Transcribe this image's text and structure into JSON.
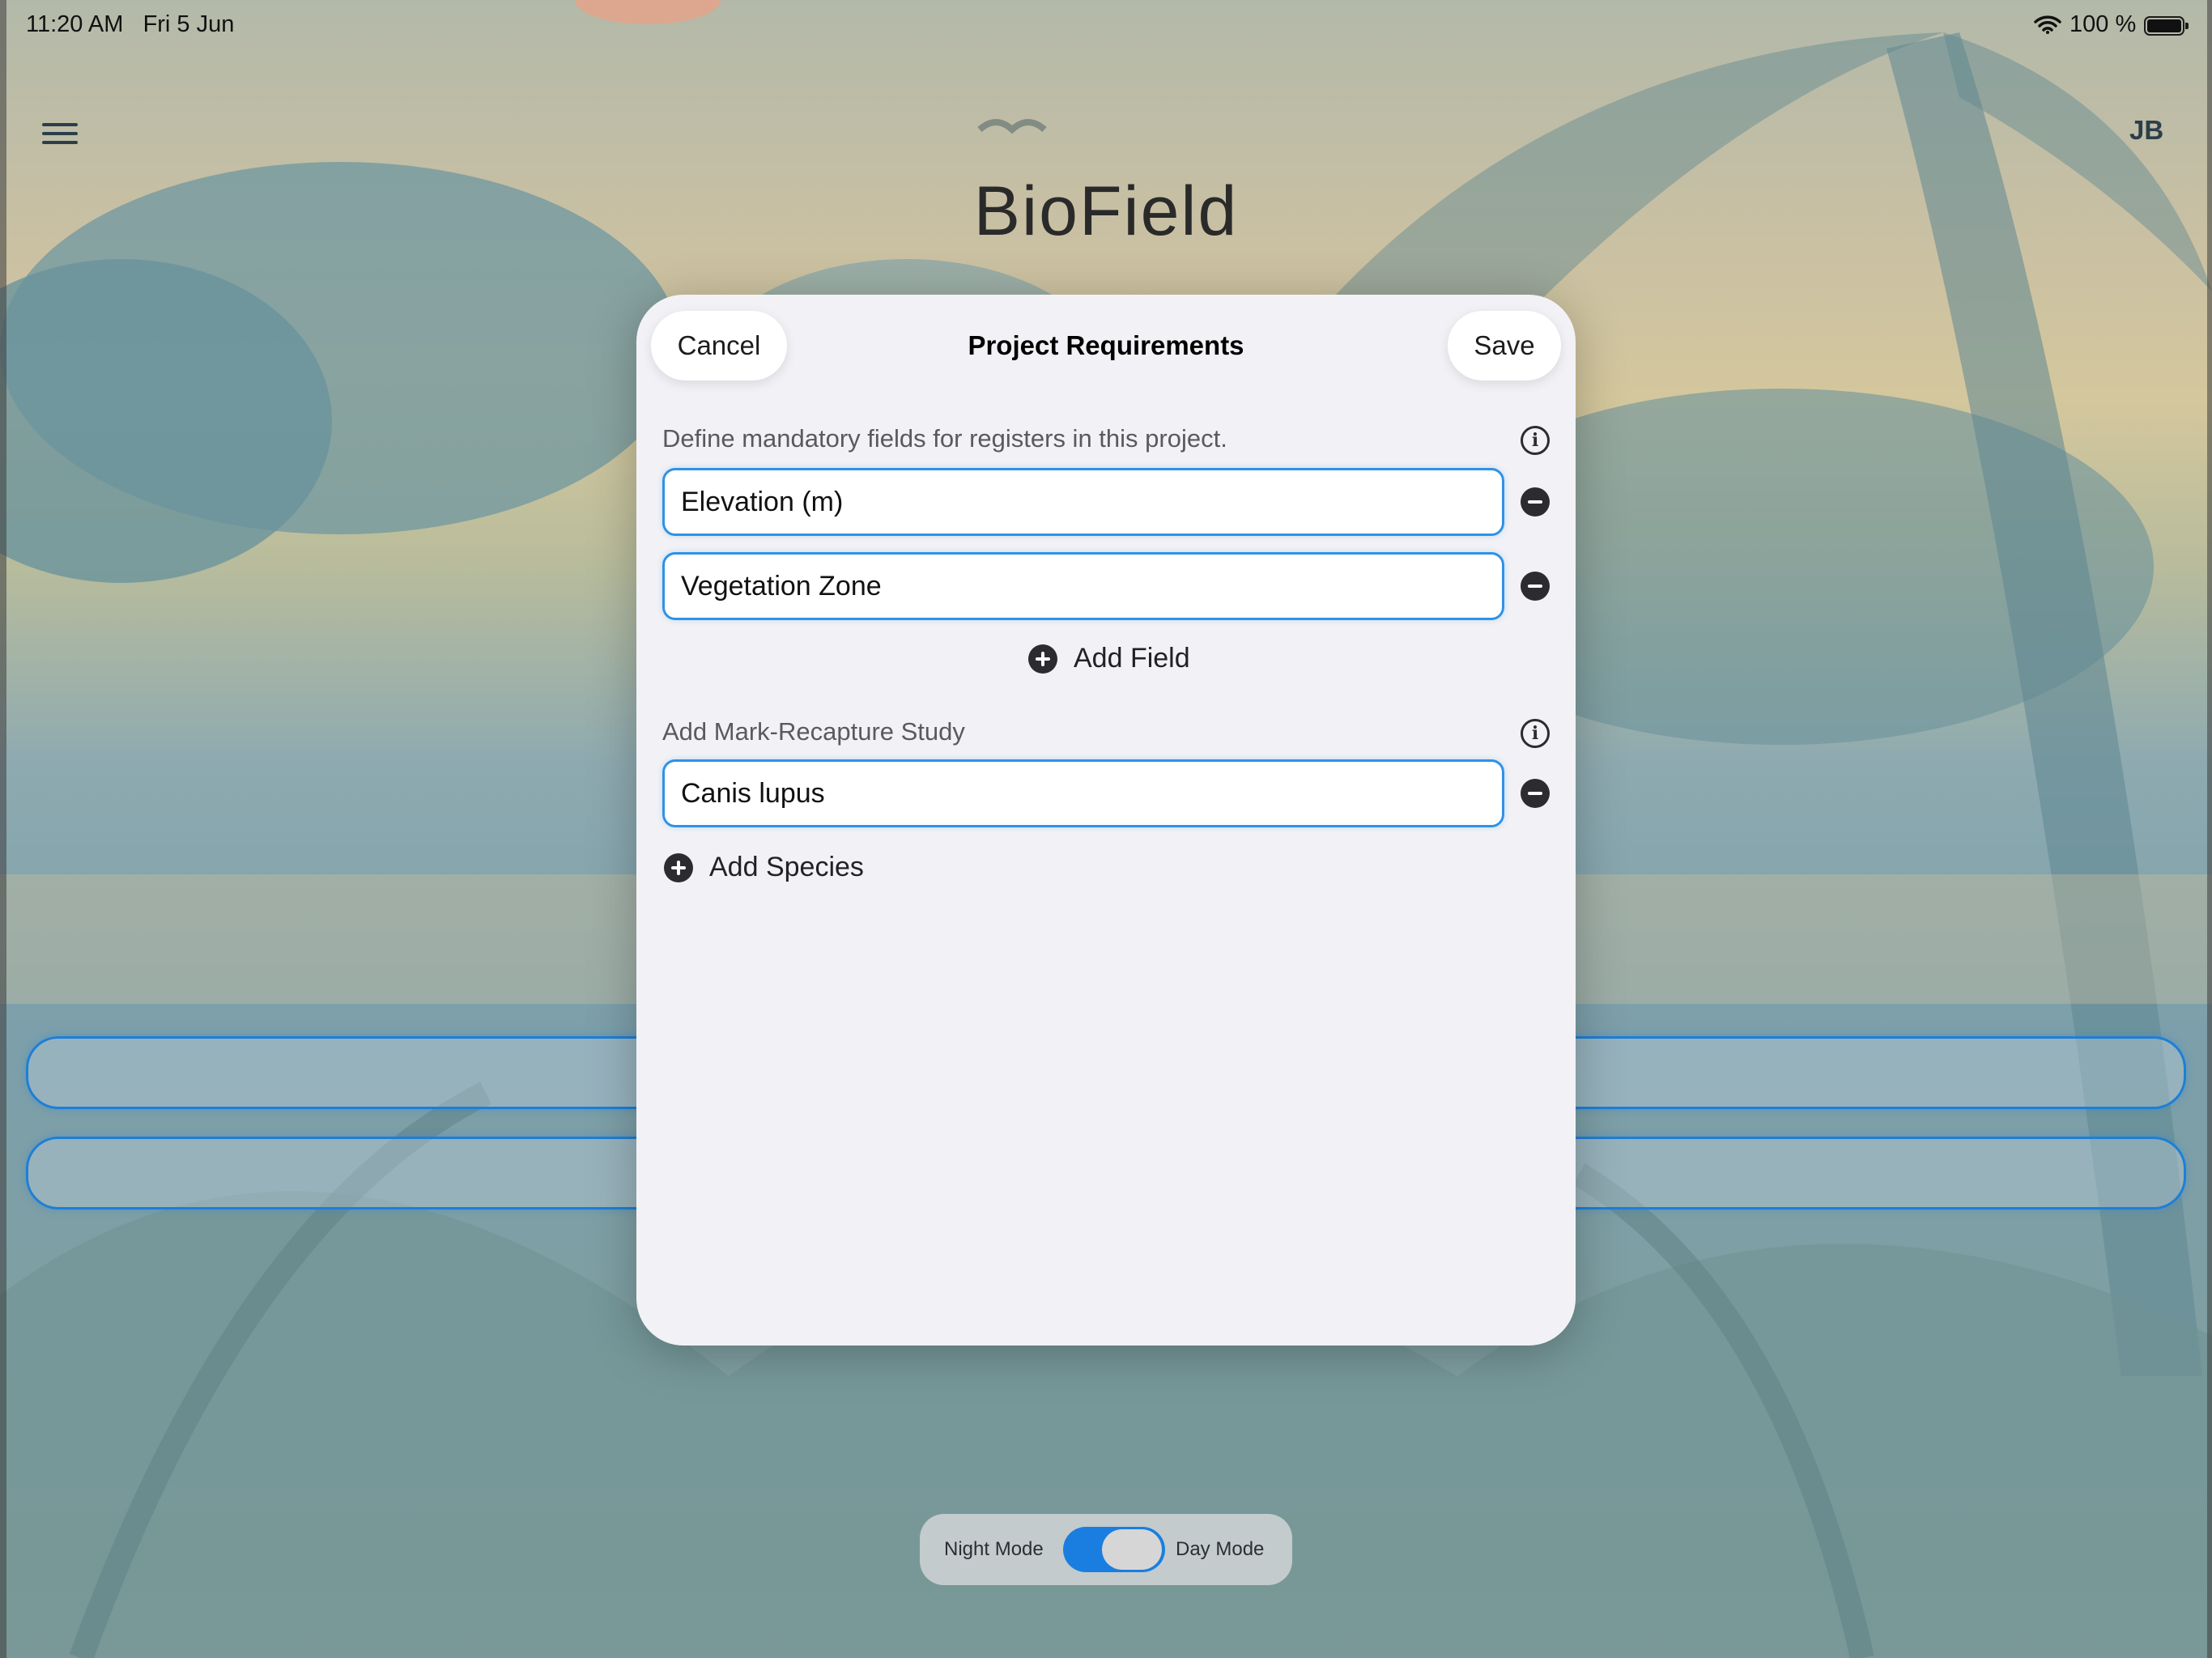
{
  "status_bar": {
    "time": "11:20 AM",
    "date": "Fri 5 Jun",
    "battery_text": "100 %"
  },
  "app": {
    "title": "BioField",
    "avatar_initials": "JB"
  },
  "mode_toggle": {
    "night_label": "Night Mode",
    "day_label": "Day Mode",
    "selected": "Day Mode"
  },
  "sheet": {
    "title": "Project Requirements",
    "cancel_label": "Cancel",
    "save_label": "Save",
    "mandatory_section": {
      "description": "Define mandatory fields for registers in this project.",
      "fields": [
        "Elevation (m)",
        "Vegetation Zone"
      ],
      "add_label": "Add Field"
    },
    "mark_recapture_section": {
      "description": "Add Mark-Recapture Study",
      "species": [
        "Canis lupus"
      ],
      "add_label": "Add Species"
    }
  },
  "colors": {
    "accent": "#1a7ee0",
    "field_border": "#2f92e6",
    "sheet_background": "#f2f2f6"
  }
}
